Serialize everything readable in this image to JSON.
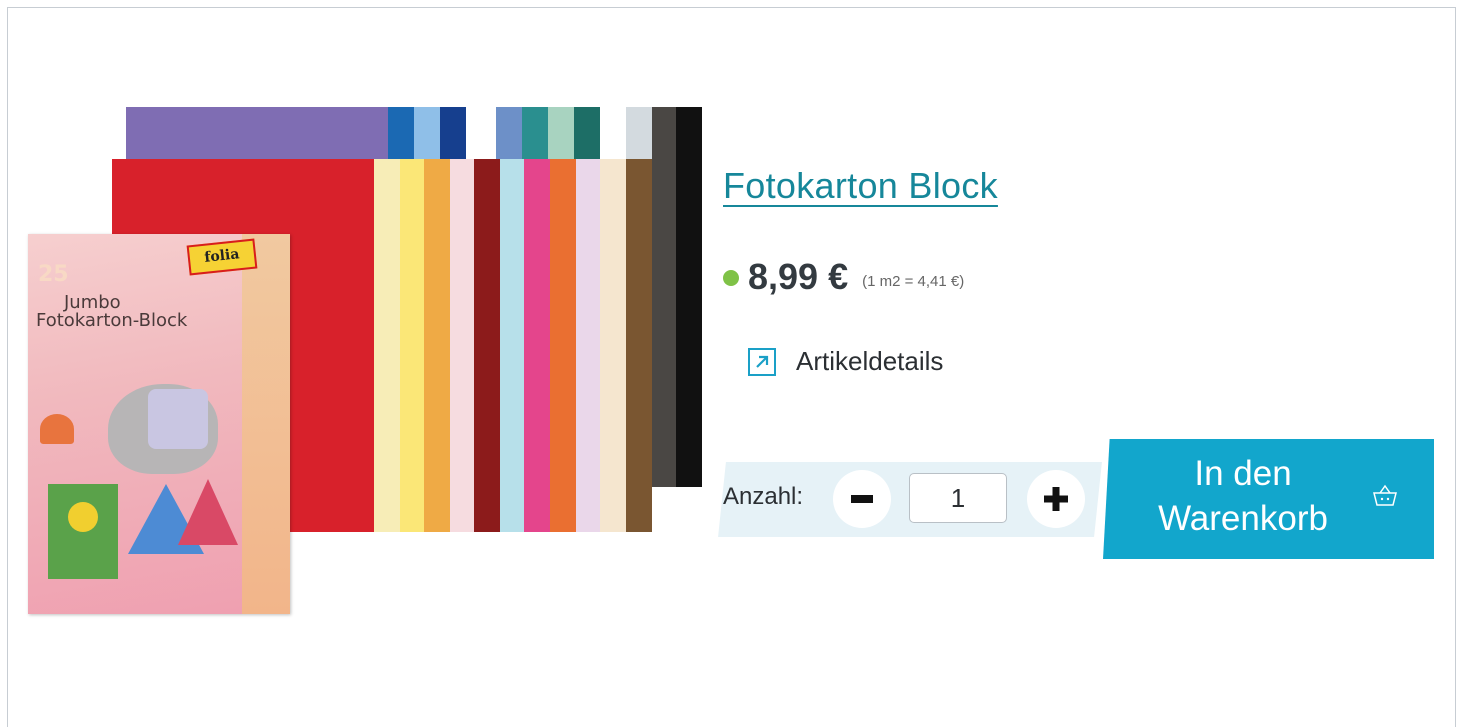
{
  "product": {
    "title": "Fotokarton Block",
    "price": "8,99 €",
    "unit_price": "(1 m2 = 4,41 €)",
    "availability_color": "#7fc247"
  },
  "details_link": {
    "label": "Artikeldetails",
    "icon": "external-arrow-icon"
  },
  "quantity": {
    "label": "Anzahl:",
    "value": "1",
    "decrease_icon": "minus-icon",
    "increase_icon": "plus-icon"
  },
  "cart": {
    "label_line1": "In den",
    "label_line2": "Warenkorb",
    "icon": "basket-icon",
    "color": "#12a6cc"
  },
  "image": {
    "brand": "folia",
    "count": "25",
    "line1": "Jumbo",
    "line2": "Fotokarton-Block",
    "back_colors": [
      "#7f6db3",
      "#1b69b3",
      "#8fbfe8",
      "#163f8e",
      "#ffffff",
      "#6d90c8",
      "#2a8f8f",
      "#a8d3c0",
      "#1d6e66",
      "#ffffff",
      "#d3dadf",
      "#4a4744",
      "#111111"
    ],
    "front_colors": [
      "#d8212b",
      "#f7edb7",
      "#fbe777",
      "#efaa45",
      "#f6dce0",
      "#8c1b1b",
      "#b7e0ea",
      "#e4458c",
      "#ea6f31",
      "#ead7ea",
      "#f5e6cf",
      "#7a5631"
    ]
  }
}
